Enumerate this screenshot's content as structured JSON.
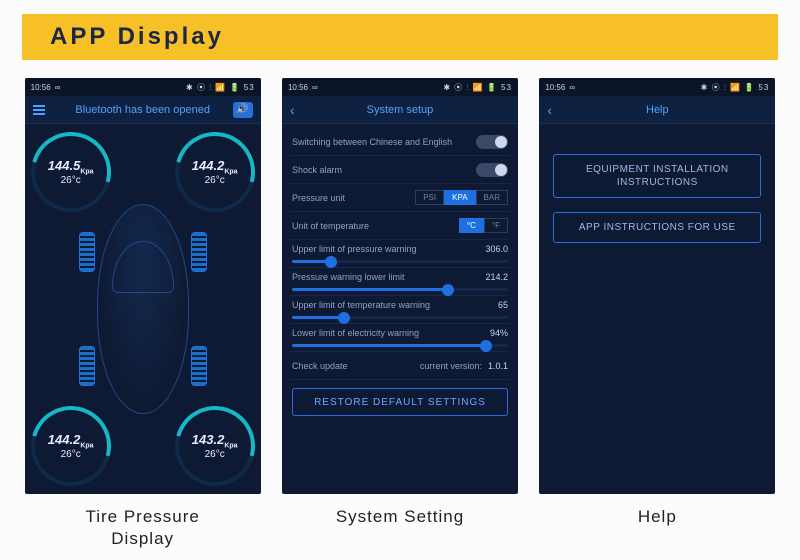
{
  "banner": {
    "title": "APP Display"
  },
  "statusbar": {
    "time": "10:56",
    "icons": "∞",
    "right": "✱ ⦿ ⫶ 📶 🔋 53"
  },
  "captions": {
    "tpms": "Tire Pressure\nDisplay",
    "settings": "System Setting",
    "help": "Help"
  },
  "tpms": {
    "title": "Bluetooth has been opened",
    "pressure_unit": "Kpa",
    "temp_unit": "°c",
    "tires": {
      "fl": {
        "pressure": "144.5",
        "temp": "26"
      },
      "fr": {
        "pressure": "144.2",
        "temp": "26"
      },
      "rl": {
        "pressure": "144.2",
        "temp": "26"
      },
      "rr": {
        "pressure": "143.2",
        "temp": "26"
      }
    }
  },
  "settings": {
    "title": "System setup",
    "lang_label": "Switching between Chinese and English",
    "shock_label": "Shock alarm",
    "pressure_unit_label": "Pressure unit",
    "pressure_units": {
      "psi": "PSI",
      "kpa": "KPA",
      "bar": "BAR",
      "active": "kpa"
    },
    "temp_unit_label": "Unit of temperature",
    "temp_units": {
      "c": "°C",
      "f": "°F",
      "active": "c"
    },
    "sliders": {
      "upper_pressure": {
        "label": "Upper limit of pressure warning",
        "value": "306.0",
        "pct": 18
      },
      "lower_pressure": {
        "label": "Pressure warning lower limit",
        "value": "214.2",
        "pct": 72
      },
      "upper_temp": {
        "label": "Upper limit of temperature warning",
        "value": "65",
        "pct": 24
      },
      "lower_elec": {
        "label": "Lower limit of electricity warning",
        "value": "94%",
        "pct": 90
      }
    },
    "update_label": "Check update",
    "version_label": "current version:",
    "version": "1.0.1",
    "restore": "RESTORE DEFAULT SETTINGS"
  },
  "help": {
    "title": "Help",
    "btn1a": "EQUIPMENT INSTALLATION",
    "btn1b": "INSTRUCTIONS",
    "btn2": "APP INSTRUCTIONS FOR USE"
  }
}
